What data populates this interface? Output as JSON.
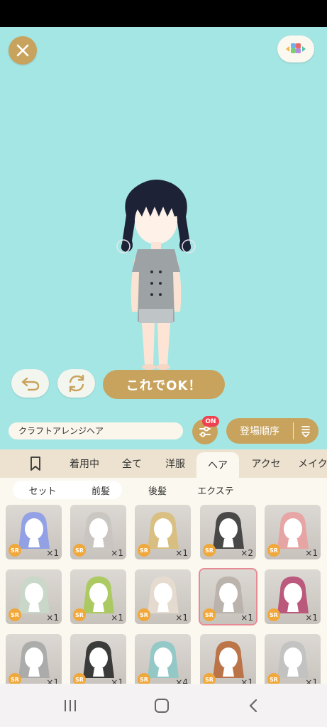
{
  "top": {
    "confirm_label": "これでOK！"
  },
  "toolbar": {
    "item_name": "クラフトアレンジヘア",
    "filter_badge": "ON",
    "sort_label": "登場順序"
  },
  "tabs": [
    {
      "label": "着用中"
    },
    {
      "label": "全て"
    },
    {
      "label": "洋服"
    },
    {
      "label": "ヘア"
    },
    {
      "label": "アクセ"
    },
    {
      "label": "メイク"
    }
  ],
  "active_tab": "ヘア",
  "subtabs": [
    {
      "label": "セット"
    },
    {
      "label": "前髪"
    },
    {
      "label": "後髪"
    },
    {
      "label": "エクステ"
    }
  ],
  "active_subtab": "後髪",
  "items": [
    {
      "rarity": "SR",
      "count": "×1",
      "color": "#8c9be8"
    },
    {
      "rarity": "SR",
      "count": "×1",
      "color": "#c9c4c0"
    },
    {
      "rarity": "SR",
      "count": "×1",
      "color": "#d9be7a"
    },
    {
      "rarity": "SR",
      "count": "×2",
      "color": "#3a3a3a"
    },
    {
      "rarity": "SR",
      "count": "×1",
      "color": "#e9a0a0"
    },
    {
      "rarity": "SR",
      "count": "×1",
      "color": "#c8d8c8"
    },
    {
      "rarity": "SR",
      "count": "×1",
      "color": "#a7c957"
    },
    {
      "rarity": "SR",
      "count": "×1",
      "color": "#e7dccf"
    },
    {
      "rarity": "SR",
      "count": "×1",
      "color": "#b8b0a8"
    },
    {
      "rarity": "SR",
      "count": "×1",
      "color": "#b84c74"
    },
    {
      "rarity": "SR",
      "count": "×1",
      "color": "#a7a7a7"
    },
    {
      "rarity": "SR",
      "count": "×1",
      "color": "#2a2a2a"
    },
    {
      "rarity": "SR",
      "count": "×4",
      "color": "#8cc8c6"
    },
    {
      "rarity": "SR",
      "count": "×1",
      "color": "#b86a3a"
    },
    {
      "rarity": "SR",
      "count": "×1",
      "color": "#c1c1c1"
    }
  ],
  "selected_item_index": 8,
  "colors": {
    "stage_bg": "#a4e6e4",
    "gold": "#c8a35e",
    "badge_red": "#ef4250",
    "cream": "#fbf8ef",
    "tab_bg": "#ede2cf"
  }
}
